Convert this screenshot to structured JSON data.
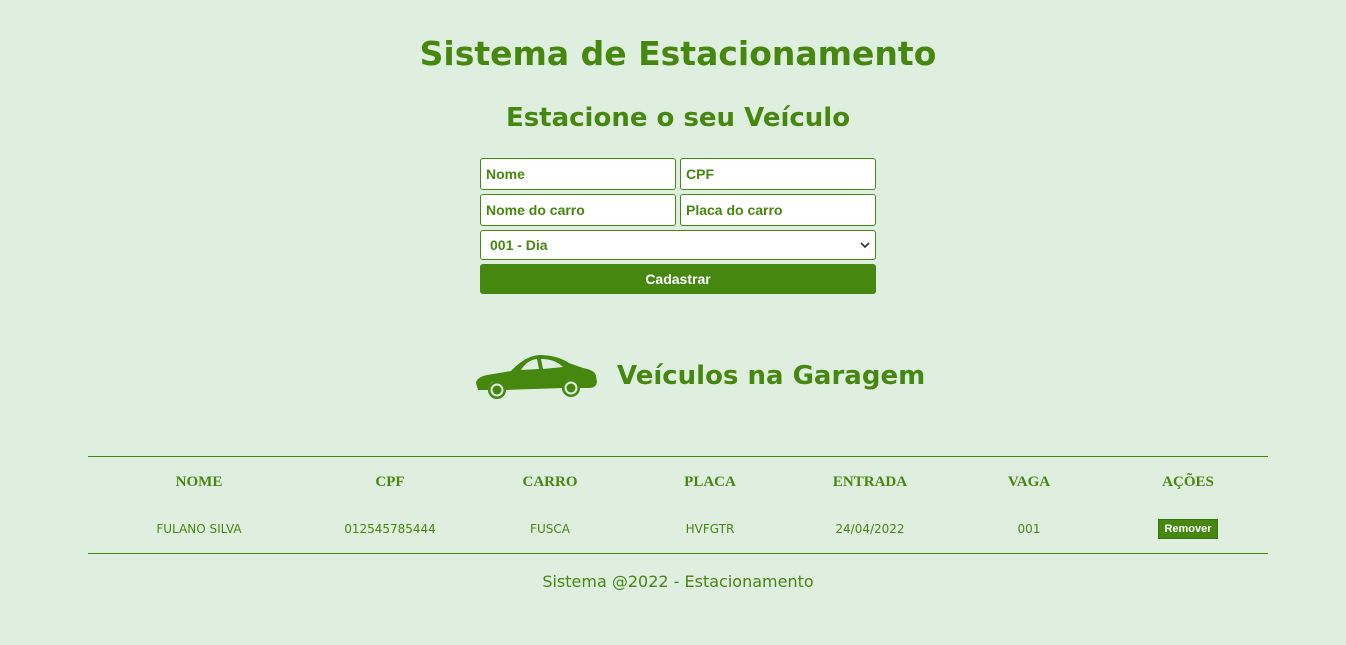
{
  "header": {
    "title": "Sistema de Estacionamento",
    "subtitle": "Estacione o seu Veículo"
  },
  "form": {
    "nome_placeholder": "Nome",
    "cpf_placeholder": "CPF",
    "carro_placeholder": "Nome do carro",
    "placa_placeholder": "Placa do carro",
    "vaga_selected": "001 - Dia",
    "submit_label": "Cadastrar"
  },
  "garage": {
    "title": "Veículos na Garagem",
    "icon": "car-icon"
  },
  "table": {
    "columns": [
      "NOME",
      "CPF",
      "CARRO",
      "PLACA",
      "ENTRADA",
      "VAGA",
      "AÇÕES"
    ],
    "rows": [
      {
        "nome": "FULANO SILVA",
        "cpf": "012545785444",
        "carro": "FUSCA",
        "placa": "HVFGTR",
        "entrada": "24/04/2022",
        "vaga": "001",
        "action_label": "Remover"
      }
    ]
  },
  "footer": {
    "text": "Sistema @2022 - Estacionamento"
  },
  "colors": {
    "background": "#dfefdf",
    "accent": "#468710"
  }
}
